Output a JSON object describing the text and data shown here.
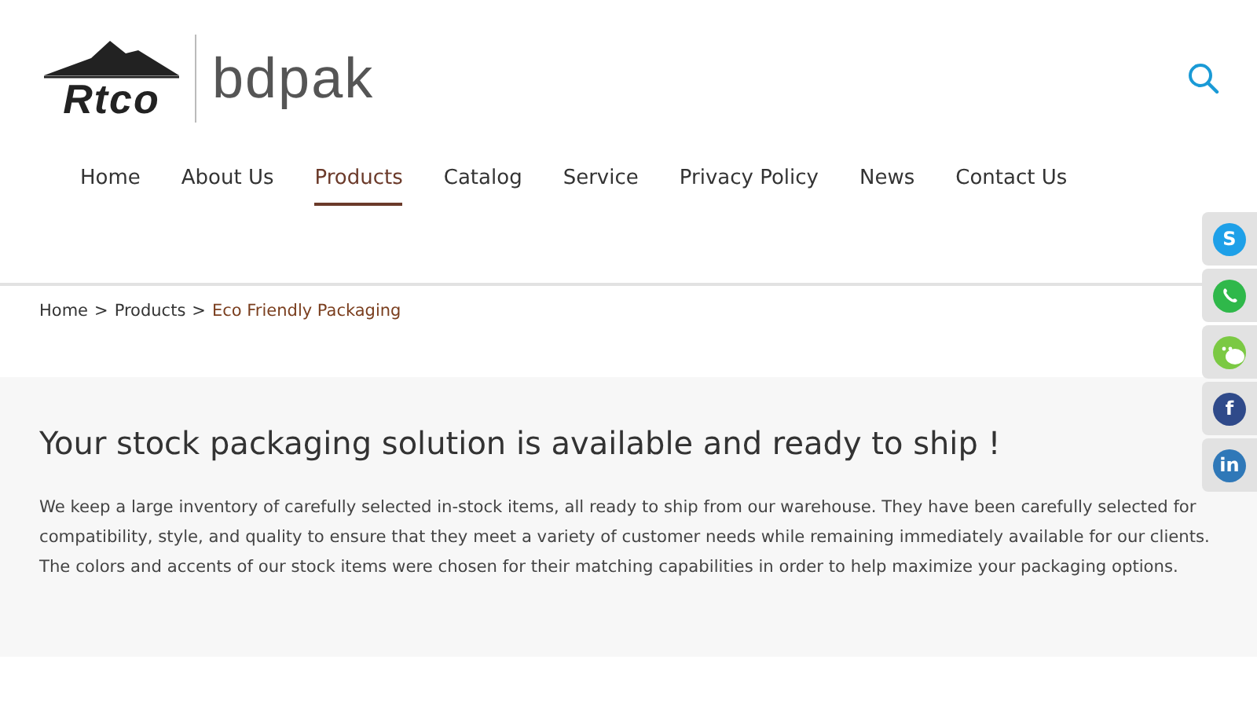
{
  "logo": {
    "brand": "Rtco",
    "partner": "bdpak"
  },
  "nav": [
    {
      "label": "Home",
      "selected": false
    },
    {
      "label": "About Us",
      "selected": false
    },
    {
      "label": "Products",
      "selected": true
    },
    {
      "label": "Catalog",
      "selected": false
    },
    {
      "label": "Service",
      "selected": false
    },
    {
      "label": "Privacy Policy",
      "selected": false
    },
    {
      "label": "News",
      "selected": false
    },
    {
      "label": "Contact Us",
      "selected": false
    }
  ],
  "breadcrumb": [
    {
      "label": "Home",
      "current": false
    },
    {
      "label": "Products",
      "current": false
    },
    {
      "label": "Eco Friendly Packaging",
      "current": true
    }
  ],
  "breadcrumb_separator": ">",
  "heading": "Your stock packaging solution is available and ready to ship !",
  "body": "We keep a large inventory of carefully selected in-stock items, all ready to ship from our warehouse. They have been carefully selected for compatibility, style, and quality to ensure that they meet a variety of customer needs while remaining immediately available for our clients. The colors and accents of our stock items were chosen for their matching capabilities in order to help maximize your packaging options.",
  "social": [
    {
      "kind": "skype",
      "glyph": "S",
      "color": "#1ea0e8"
    },
    {
      "kind": "whatsapp",
      "color": "#2fb84a"
    },
    {
      "kind": "wechat",
      "color": "#7bc943"
    },
    {
      "kind": "facebook",
      "glyph": "f",
      "color": "#2f4a8a"
    },
    {
      "kind": "linkedin",
      "glyph": "in",
      "color": "#2f78b8"
    }
  ]
}
